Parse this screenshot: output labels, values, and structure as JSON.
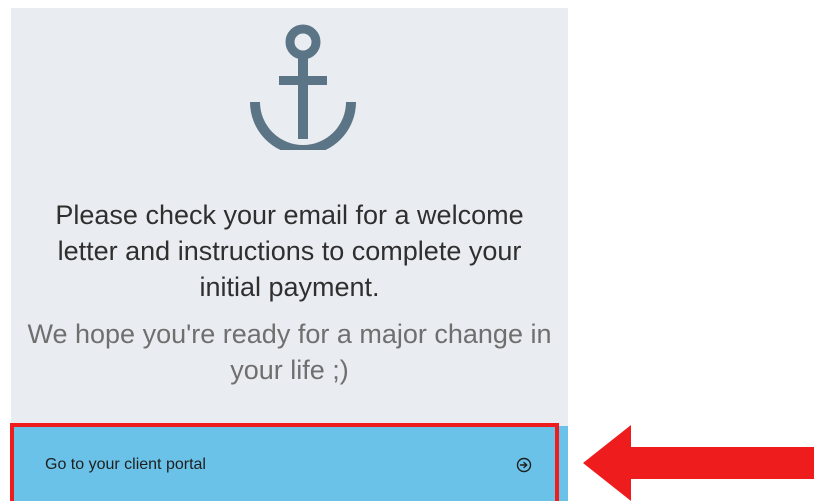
{
  "card": {
    "icon": "anchor-icon",
    "message_lines": [
      "Please check your email for a welcome",
      "letter and instructions to complete your",
      "initial payment."
    ],
    "sub_lines": [
      "We hope you're ready for a major",
      "change in your life ;)"
    ]
  },
  "portal_button": {
    "label": "Go to your client portal",
    "icon": "arrow-circle-right-icon"
  },
  "annotation": {
    "highlight_color": "#ee1c1c",
    "arrow_icon": "red-arrow-left-icon"
  },
  "colors": {
    "card_background": "#e9edf1",
    "anchor": "#5b7486",
    "button_background": "#6bc2e8"
  }
}
